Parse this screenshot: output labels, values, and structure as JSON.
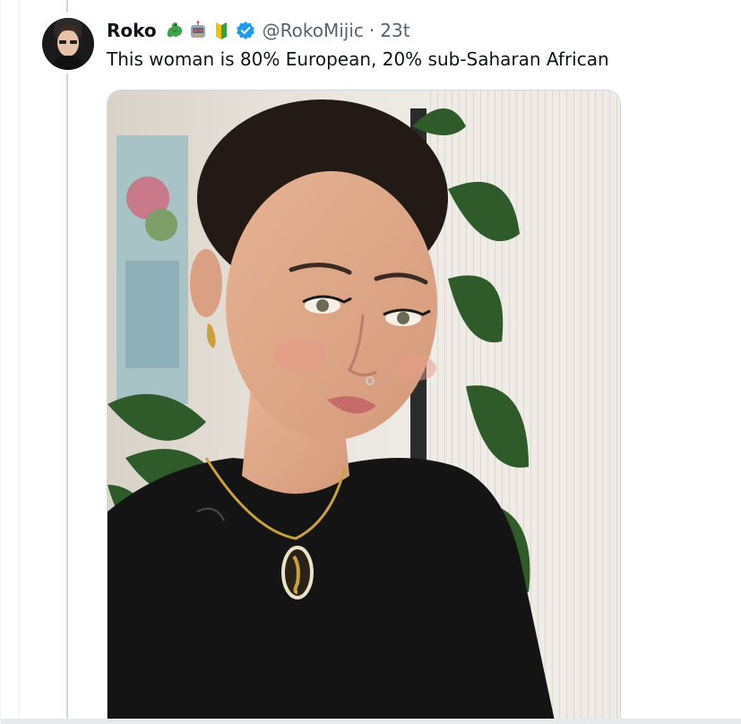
{
  "tweet": {
    "display_name": "Roko",
    "emojis": [
      "dragon-emoji",
      "robot-emoji",
      "beginner-badge-emoji"
    ],
    "verified": true,
    "handle": "@RokoMijic",
    "separator": "·",
    "time": "23t",
    "text": "This woman is 80% European, 20% sub-Saharan African"
  },
  "media": {
    "icon": "photo-selfie"
  },
  "colors": {
    "text": "#0f1419",
    "muted": "#536471",
    "verified": "#1d9bf0",
    "thread_line": "#cfd9de"
  }
}
